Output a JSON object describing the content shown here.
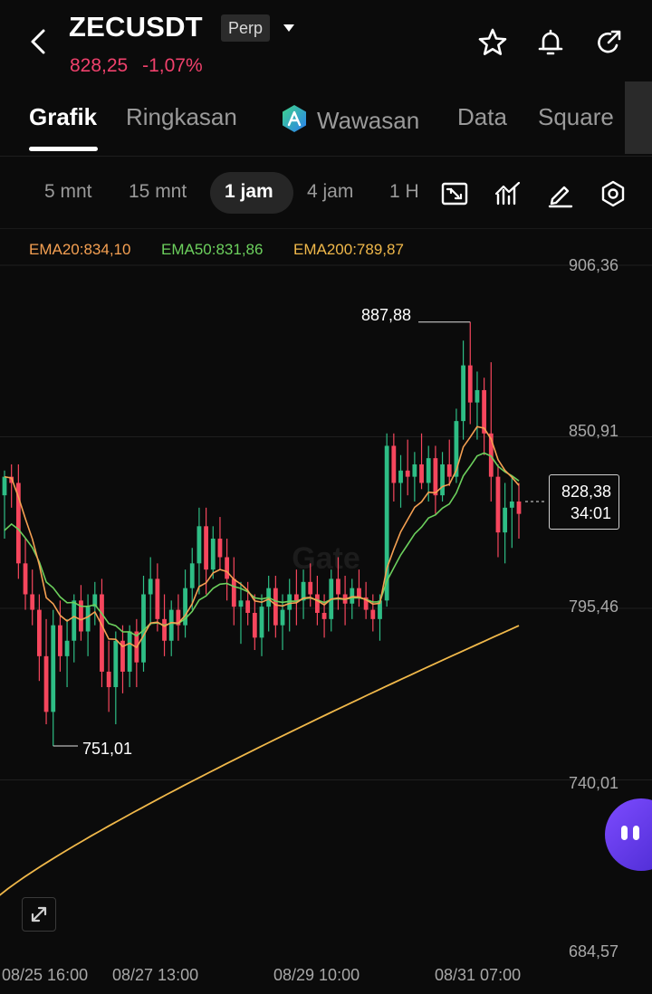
{
  "header": {
    "symbol": "ZECUSDT",
    "contract_badge": "Perp",
    "last_price": "828,25",
    "change_pct": "-1,07%"
  },
  "tabs": [
    {
      "label": "Grafik",
      "active": true
    },
    {
      "label": "Ringkasan",
      "active": false
    },
    {
      "label": "Wawasan",
      "active": false
    },
    {
      "label": "Data",
      "active": false
    },
    {
      "label": "Square",
      "active": false
    }
  ],
  "intervals": [
    {
      "label": "5 mnt",
      "active": false
    },
    {
      "label": "15 mnt",
      "active": false
    },
    {
      "label": "1 jam",
      "active": true
    },
    {
      "label": "4 jam",
      "active": false
    },
    {
      "label": "1 H",
      "active": false
    }
  ],
  "indicators": {
    "ema20": "EMA20:834,10",
    "ema50": "EMA50:831,86",
    "ema200": "EMA200:789,87"
  },
  "colors": {
    "up": "#2ebd85",
    "down": "#f6465d",
    "ema20": "#f5a052",
    "ema50": "#6cd05d",
    "ema200": "#f0b84a",
    "accent": "#f0416c"
  },
  "icons": [
    "back-icon",
    "caret-down-icon",
    "star-icon",
    "bell-icon",
    "share-icon",
    "ai-icon",
    "chart-type-icon",
    "indicator-icon",
    "draw-icon",
    "settings-icon",
    "expand-icon"
  ],
  "chart_data": {
    "type": "candlestick",
    "y_ticks": [
      "906,36",
      "850,91",
      "795,46",
      "740,01",
      "684,57"
    ],
    "x_ticks": [
      "08/25 16:00",
      "08/27 13:00",
      "08/29 10:00",
      "08/31 07:00"
    ],
    "ylim": [
      684.57,
      906.36
    ],
    "high_marker": "887,88",
    "low_marker": "751,01",
    "current_price": "828,38",
    "countdown": "34:01",
    "candles_ohlc": [
      [
        832,
        840,
        818,
        838
      ],
      [
        838,
        842,
        828,
        836
      ],
      [
        836,
        842,
        805,
        810
      ],
      [
        810,
        818,
        795,
        800
      ],
      [
        800,
        808,
        790,
        795
      ],
      [
        795,
        800,
        772,
        780
      ],
      [
        780,
        792,
        758,
        762
      ],
      [
        762,
        795,
        751,
        790
      ],
      [
        790,
        798,
        775,
        780
      ],
      [
        780,
        792,
        770,
        785
      ],
      [
        785,
        800,
        778,
        798
      ],
      [
        798,
        803,
        785,
        788
      ],
      [
        788,
        800,
        780,
        796
      ],
      [
        796,
        804,
        790,
        800
      ],
      [
        800,
        805,
        770,
        775
      ],
      [
        775,
        785,
        762,
        770
      ],
      [
        770,
        788,
        758,
        785
      ],
      [
        785,
        790,
        768,
        775
      ],
      [
        775,
        790,
        770,
        788
      ],
      [
        788,
        792,
        770,
        778
      ],
      [
        778,
        806,
        775,
        800
      ],
      [
        800,
        812,
        790,
        805
      ],
      [
        805,
        810,
        788,
        792
      ],
      [
        792,
        800,
        780,
        785
      ],
      [
        785,
        798,
        780,
        795
      ],
      [
        795,
        800,
        785,
        790
      ],
      [
        790,
        808,
        786,
        802
      ],
      [
        802,
        815,
        795,
        810
      ],
      [
        810,
        828,
        800,
        822
      ],
      [
        822,
        828,
        800,
        808
      ],
      [
        808,
        822,
        805,
        818
      ],
      [
        818,
        825,
        808,
        812
      ],
      [
        812,
        818,
        798,
        805
      ],
      [
        805,
        812,
        790,
        796
      ],
      [
        796,
        804,
        784,
        798
      ],
      [
        798,
        804,
        790,
        794
      ],
      [
        794,
        800,
        782,
        786
      ],
      [
        786,
        800,
        780,
        796
      ],
      [
        796,
        806,
        788,
        802
      ],
      [
        802,
        806,
        786,
        790
      ],
      [
        790,
        800,
        782,
        795
      ],
      [
        795,
        805,
        788,
        800
      ],
      [
        800,
        808,
        790,
        798
      ],
      [
        798,
        808,
        792,
        804
      ],
      [
        804,
        810,
        796,
        800
      ],
      [
        800,
        806,
        790,
        794
      ],
      [
        794,
        800,
        786,
        792
      ],
      [
        792,
        808,
        788,
        805
      ],
      [
        805,
        812,
        795,
        800
      ],
      [
        800,
        806,
        790,
        797
      ],
      [
        797,
        805,
        792,
        802
      ],
      [
        802,
        808,
        796,
        799
      ],
      [
        799,
        804,
        792,
        795
      ],
      [
        795,
        800,
        788,
        792
      ],
      [
        792,
        800,
        785,
        798
      ],
      [
        798,
        852,
        796,
        848
      ],
      [
        848,
        852,
        830,
        836
      ],
      [
        836,
        845,
        828,
        840
      ],
      [
        840,
        850,
        832,
        838
      ],
      [
        838,
        846,
        830,
        842
      ],
      [
        842,
        852,
        834,
        836
      ],
      [
        836,
        848,
        830,
        844
      ],
      [
        844,
        848,
        826,
        832
      ],
      [
        832,
        846,
        830,
        842
      ],
      [
        842,
        850,
        835,
        838
      ],
      [
        838,
        860,
        836,
        856
      ],
      [
        856,
        882,
        850,
        874
      ],
      [
        874,
        888,
        855,
        862
      ],
      [
        862,
        872,
        850,
        866
      ],
      [
        866,
        870,
        845,
        852
      ],
      [
        852,
        875,
        830,
        838
      ],
      [
        838,
        842,
        812,
        820
      ],
      [
        820,
        836,
        810,
        828
      ],
      [
        828,
        838,
        815,
        830
      ],
      [
        830,
        836,
        818,
        826
      ]
    ]
  }
}
